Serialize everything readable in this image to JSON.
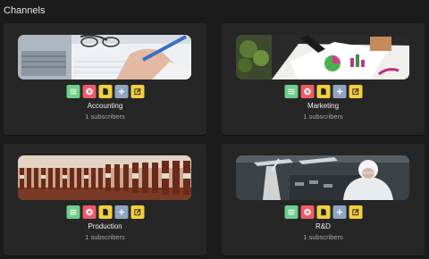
{
  "page": {
    "title": "Channels"
  },
  "channels": [
    {
      "name": "Accounting",
      "subscribers": "1 subscribers",
      "image_icon": "pen-writing-photo"
    },
    {
      "name": "Marketing",
      "subscribers": "1 subscribers",
      "image_icon": "charts-desk-photo"
    },
    {
      "name": "Production",
      "subscribers": "1 subscribers",
      "image_icon": "bottles-line-photo"
    },
    {
      "name": "R&D",
      "subscribers": "1 subscribers",
      "image_icon": "lab-worker-photo"
    }
  ],
  "actions": [
    {
      "name": "list-icon",
      "color": "#6dcf8a"
    },
    {
      "name": "delete-icon",
      "color": "#ee5a67"
    },
    {
      "name": "file-icon",
      "color": "#f2cf3d"
    },
    {
      "name": "plus-icon",
      "color": "#8fa6c2"
    },
    {
      "name": "edit-icon",
      "color": "#f2cf3d"
    }
  ]
}
